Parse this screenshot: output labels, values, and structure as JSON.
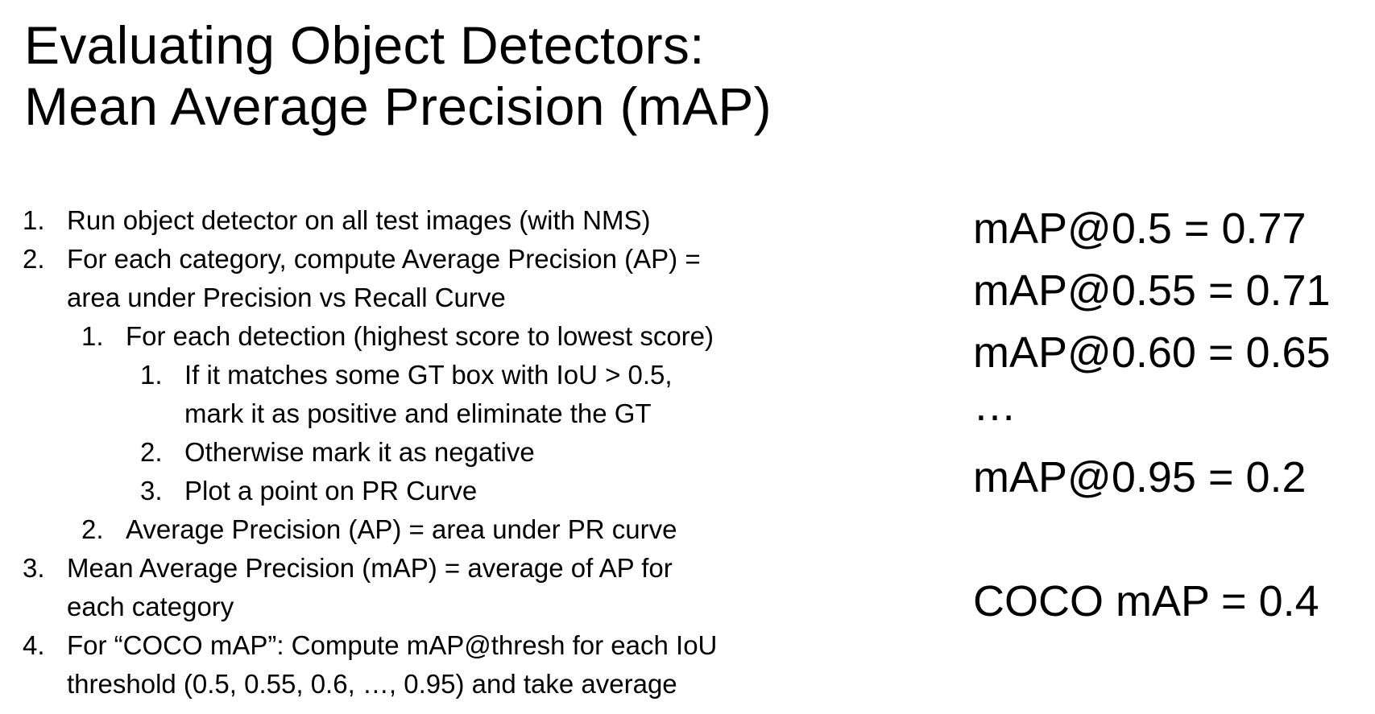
{
  "slide": {
    "title_line1": "Evaluating Object Detectors:",
    "title_line2": "Mean Average Precision (mAP)",
    "steps": [
      {
        "num": "1.",
        "text": "Run object detector on all test images (with NMS)"
      },
      {
        "num": "2.",
        "text": "For each category, compute Average Precision (AP) =",
        "cont": "area under Precision vs Recall Curve"
      },
      {
        "num": "1.",
        "text": "For each detection (highest score to lowest score)"
      },
      {
        "num": "1.",
        "text": "If it matches some GT box with IoU > 0.5,",
        "cont": "mark it as positive and eliminate the GT"
      },
      {
        "num": "2.",
        "text": "Otherwise mark it as negative"
      },
      {
        "num": "3.",
        "text": "Plot a point on PR Curve"
      },
      {
        "num": "2.",
        "text": "Average Precision (AP) = area under PR curve"
      },
      {
        "num": "3.",
        "text": "Mean Average Precision (mAP) = average of AP for",
        "cont": "each category"
      },
      {
        "num": "4.",
        "text": "For “COCO mAP”: Compute mAP@thresh for each IoU",
        "cont": "threshold (0.5, 0.55, 0.6, …, 0.95) and take average"
      }
    ],
    "results": [
      "mAP@0.5 = 0.77",
      "mAP@0.55 = 0.71",
      "mAP@0.60 = 0.65",
      "…",
      "mAP@0.95 = 0.2",
      "COCO mAP = 0.4"
    ]
  }
}
